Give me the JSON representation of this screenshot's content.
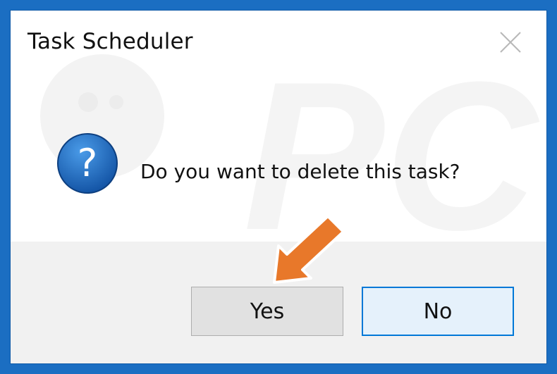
{
  "window": {
    "title": "Task Scheduler"
  },
  "dialog": {
    "message": "Do you want to delete this task?",
    "icon": "question-icon",
    "buttons": {
      "yes_label": "Yes",
      "no_label": "No"
    }
  },
  "annotation": {
    "type": "arrow",
    "color": "#e8782a",
    "points_to": "yes-button"
  },
  "watermark_text": "PC risk.com",
  "colors": {
    "accent": "#0078d7",
    "frame": "#1b6ec2",
    "icon_blue": "#1c62b8"
  }
}
